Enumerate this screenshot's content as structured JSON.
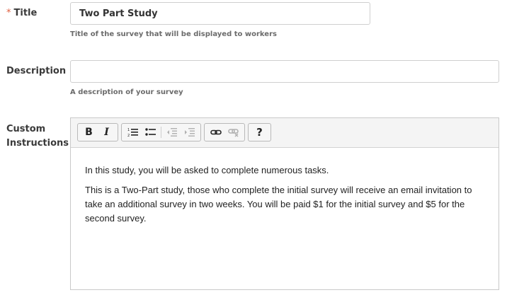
{
  "title_field": {
    "label": "Title",
    "required_marker": "*",
    "value": "Two Part Study",
    "help": "Title of the survey that will be displayed to workers"
  },
  "description_field": {
    "label": "Description",
    "value": "",
    "help": "A description of your survey"
  },
  "instructions_field": {
    "label_line1": "Custom",
    "label_line2": "Instructions",
    "toolbar": {
      "bold": "B",
      "italic": "I",
      "help": "?"
    },
    "paragraphs": [
      "In this study, you will be asked to complete numerous tasks.",
      "This is a Two-Part study, those who complete the initial survey will receive an email invitation to take an additional survey in two weeks. You will be paid $1 for the initial survey and $5 for the second survey."
    ]
  },
  "icons": {
    "numbered_list": "numbered-list-icon",
    "bulleted_list": "bulleted-list-icon",
    "outdent": "outdent-icon",
    "indent": "indent-icon",
    "link": "link-icon",
    "unlink": "unlink-icon"
  },
  "colors": {
    "required": "#e06040",
    "label": "#3a3a3a",
    "help_text": "#6b6b6b",
    "border": "#cfcfcf"
  }
}
